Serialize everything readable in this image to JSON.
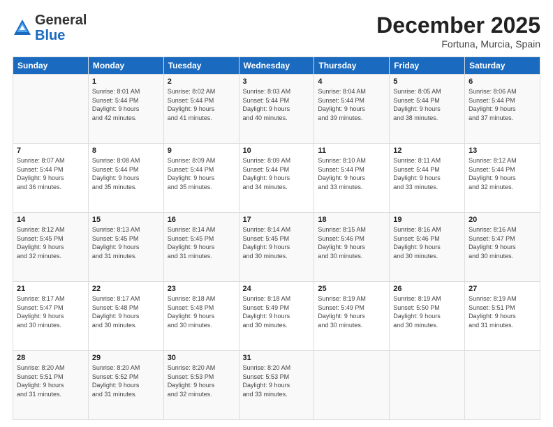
{
  "header": {
    "logo_general": "General",
    "logo_blue": "Blue",
    "month_title": "December 2025",
    "location": "Fortuna, Murcia, Spain"
  },
  "weekdays": [
    "Sunday",
    "Monday",
    "Tuesday",
    "Wednesday",
    "Thursday",
    "Friday",
    "Saturday"
  ],
  "weeks": [
    [
      {
        "day": "",
        "info": ""
      },
      {
        "day": "1",
        "info": "Sunrise: 8:01 AM\nSunset: 5:44 PM\nDaylight: 9 hours\nand 42 minutes."
      },
      {
        "day": "2",
        "info": "Sunrise: 8:02 AM\nSunset: 5:44 PM\nDaylight: 9 hours\nand 41 minutes."
      },
      {
        "day": "3",
        "info": "Sunrise: 8:03 AM\nSunset: 5:44 PM\nDaylight: 9 hours\nand 40 minutes."
      },
      {
        "day": "4",
        "info": "Sunrise: 8:04 AM\nSunset: 5:44 PM\nDaylight: 9 hours\nand 39 minutes."
      },
      {
        "day": "5",
        "info": "Sunrise: 8:05 AM\nSunset: 5:44 PM\nDaylight: 9 hours\nand 38 minutes."
      },
      {
        "day": "6",
        "info": "Sunrise: 8:06 AM\nSunset: 5:44 PM\nDaylight: 9 hours\nand 37 minutes."
      }
    ],
    [
      {
        "day": "7",
        "info": "Sunrise: 8:07 AM\nSunset: 5:44 PM\nDaylight: 9 hours\nand 36 minutes."
      },
      {
        "day": "8",
        "info": "Sunrise: 8:08 AM\nSunset: 5:44 PM\nDaylight: 9 hours\nand 35 minutes."
      },
      {
        "day": "9",
        "info": "Sunrise: 8:09 AM\nSunset: 5:44 PM\nDaylight: 9 hours\nand 35 minutes."
      },
      {
        "day": "10",
        "info": "Sunrise: 8:09 AM\nSunset: 5:44 PM\nDaylight: 9 hours\nand 34 minutes."
      },
      {
        "day": "11",
        "info": "Sunrise: 8:10 AM\nSunset: 5:44 PM\nDaylight: 9 hours\nand 33 minutes."
      },
      {
        "day": "12",
        "info": "Sunrise: 8:11 AM\nSunset: 5:44 PM\nDaylight: 9 hours\nand 33 minutes."
      },
      {
        "day": "13",
        "info": "Sunrise: 8:12 AM\nSunset: 5:44 PM\nDaylight: 9 hours\nand 32 minutes."
      }
    ],
    [
      {
        "day": "14",
        "info": "Sunrise: 8:12 AM\nSunset: 5:45 PM\nDaylight: 9 hours\nand 32 minutes."
      },
      {
        "day": "15",
        "info": "Sunrise: 8:13 AM\nSunset: 5:45 PM\nDaylight: 9 hours\nand 31 minutes."
      },
      {
        "day": "16",
        "info": "Sunrise: 8:14 AM\nSunset: 5:45 PM\nDaylight: 9 hours\nand 31 minutes."
      },
      {
        "day": "17",
        "info": "Sunrise: 8:14 AM\nSunset: 5:45 PM\nDaylight: 9 hours\nand 30 minutes."
      },
      {
        "day": "18",
        "info": "Sunrise: 8:15 AM\nSunset: 5:46 PM\nDaylight: 9 hours\nand 30 minutes."
      },
      {
        "day": "19",
        "info": "Sunrise: 8:16 AM\nSunset: 5:46 PM\nDaylight: 9 hours\nand 30 minutes."
      },
      {
        "day": "20",
        "info": "Sunrise: 8:16 AM\nSunset: 5:47 PM\nDaylight: 9 hours\nand 30 minutes."
      }
    ],
    [
      {
        "day": "21",
        "info": "Sunrise: 8:17 AM\nSunset: 5:47 PM\nDaylight: 9 hours\nand 30 minutes."
      },
      {
        "day": "22",
        "info": "Sunrise: 8:17 AM\nSunset: 5:48 PM\nDaylight: 9 hours\nand 30 minutes."
      },
      {
        "day": "23",
        "info": "Sunrise: 8:18 AM\nSunset: 5:48 PM\nDaylight: 9 hours\nand 30 minutes."
      },
      {
        "day": "24",
        "info": "Sunrise: 8:18 AM\nSunset: 5:49 PM\nDaylight: 9 hours\nand 30 minutes."
      },
      {
        "day": "25",
        "info": "Sunrise: 8:19 AM\nSunset: 5:49 PM\nDaylight: 9 hours\nand 30 minutes."
      },
      {
        "day": "26",
        "info": "Sunrise: 8:19 AM\nSunset: 5:50 PM\nDaylight: 9 hours\nand 30 minutes."
      },
      {
        "day": "27",
        "info": "Sunrise: 8:19 AM\nSunset: 5:51 PM\nDaylight: 9 hours\nand 31 minutes."
      }
    ],
    [
      {
        "day": "28",
        "info": "Sunrise: 8:20 AM\nSunset: 5:51 PM\nDaylight: 9 hours\nand 31 minutes."
      },
      {
        "day": "29",
        "info": "Sunrise: 8:20 AM\nSunset: 5:52 PM\nDaylight: 9 hours\nand 31 minutes."
      },
      {
        "day": "30",
        "info": "Sunrise: 8:20 AM\nSunset: 5:53 PM\nDaylight: 9 hours\nand 32 minutes."
      },
      {
        "day": "31",
        "info": "Sunrise: 8:20 AM\nSunset: 5:53 PM\nDaylight: 9 hours\nand 33 minutes."
      },
      {
        "day": "",
        "info": ""
      },
      {
        "day": "",
        "info": ""
      },
      {
        "day": "",
        "info": ""
      }
    ]
  ]
}
